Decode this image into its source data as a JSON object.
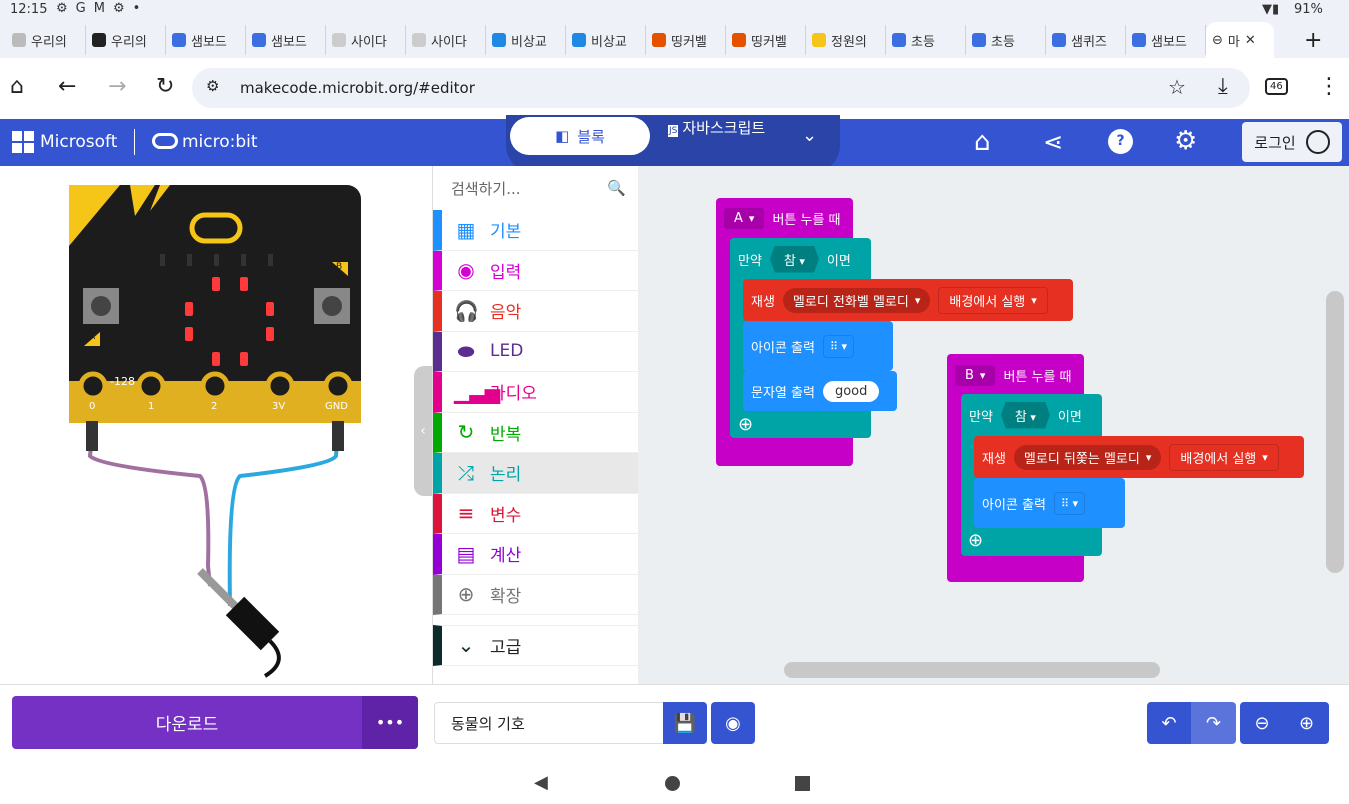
{
  "status": {
    "time": "12:15",
    "icons": [
      "gear-icon",
      "G",
      "M",
      "gear-icon",
      "•"
    ],
    "battery": "91%"
  },
  "tabs": [
    {
      "label": "우리의",
      "color": "#bbb"
    },
    {
      "label": "우리의",
      "color": "#222"
    },
    {
      "label": "샘보드",
      "color": "#3b6fe0"
    },
    {
      "label": "샘보드",
      "color": "#3b6fe0"
    },
    {
      "label": "사이다",
      "color": "#ccc"
    },
    {
      "label": "사이다",
      "color": "#ccc"
    },
    {
      "label": "비상교",
      "color": "#1e88e5"
    },
    {
      "label": "비상교",
      "color": "#1e88e5"
    },
    {
      "label": "띵커벨",
      "color": "#e65100"
    },
    {
      "label": "띵커벨",
      "color": "#e65100"
    },
    {
      "label": "정원의",
      "color": "#f5c518"
    },
    {
      "label": "초등",
      "color": "#3b6fe0"
    },
    {
      "label": "초등",
      "color": "#3b6fe0"
    },
    {
      "label": "샘퀴즈",
      "color": "#3b6fe0"
    },
    {
      "label": "샘보드",
      "color": "#3b6fe0"
    }
  ],
  "active_tab": {
    "label": "마",
    "close": "✕"
  },
  "new_tab": "+",
  "url": "makecode.microbit.org/#editor",
  "tab_count": "46",
  "header": {
    "brand": "Microsoft",
    "product": "micro:bit",
    "tab_blocks": "블록",
    "tab_js": "자바스크립트",
    "login": "로그인"
  },
  "search_placeholder": "검색하기...",
  "categories": [
    {
      "label": "기본",
      "color": "#1e90ff",
      "icon": "▦"
    },
    {
      "label": "입력",
      "color": "#d400d4",
      "icon": "◉"
    },
    {
      "label": "음악",
      "color": "#e63022",
      "icon": "🎧"
    },
    {
      "label": "LED",
      "color": "#5c2d91",
      "icon": "⬬"
    },
    {
      "label": "라디오",
      "color": "#e3008c",
      "icon": "▁▃▅"
    },
    {
      "label": "반복",
      "color": "#00aa00",
      "icon": "↻"
    },
    {
      "label": "논리",
      "color": "#00a4a6",
      "icon": "⤮"
    },
    {
      "label": "변수",
      "color": "#dc143c",
      "icon": "≡"
    },
    {
      "label": "계산",
      "color": "#9400d3",
      "icon": "▤"
    },
    {
      "label": "확장",
      "color": "#757575",
      "icon": "⊕"
    },
    {
      "label": "고급",
      "color": "#0d2b2b",
      "icon": "⌄"
    }
  ],
  "sim": {
    "pin_labels": [
      "0",
      "1",
      "2",
      "3V",
      "GND"
    ],
    "value": "-128",
    "btn_a": "A",
    "btn_b": "B"
  },
  "blocks": {
    "a": {
      "button": "A",
      "event": "버튼 누를 때",
      "if": "만약",
      "cond": "참",
      "then": "이면",
      "play": "재생",
      "melody": "멜로디 전화벨 멜로디",
      "mode": "배경에서 실행",
      "icon": "아이콘 출력",
      "string": "문자열 출력",
      "text": "good"
    },
    "b": {
      "button": "B",
      "event": "버튼 누를 때",
      "if": "만약",
      "cond": "참",
      "then": "이면",
      "play": "재생",
      "melody": "멜로디 뒤쫓는 멜로디",
      "mode": "배경에서 실행",
      "icon": "아이콘 출력"
    }
  },
  "bottom": {
    "download": "다운로드",
    "more": "•••",
    "project_name": "동물의 기호"
  }
}
